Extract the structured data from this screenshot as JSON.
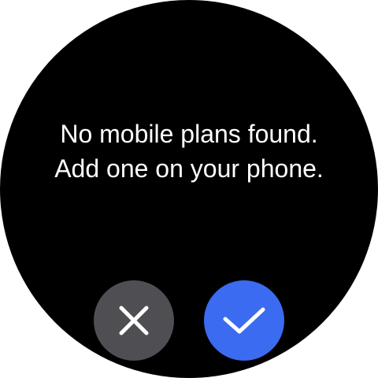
{
  "dialog": {
    "message_line1": "No mobile plans found.",
    "message_line2": "Add one on your phone."
  },
  "buttons": {
    "cancel": {
      "icon": "close-icon",
      "color": "#4f4f53"
    },
    "confirm": {
      "icon": "check-icon",
      "color": "#3b6bf0"
    }
  },
  "colors": {
    "background": "#000000",
    "text": "#ffffff"
  }
}
